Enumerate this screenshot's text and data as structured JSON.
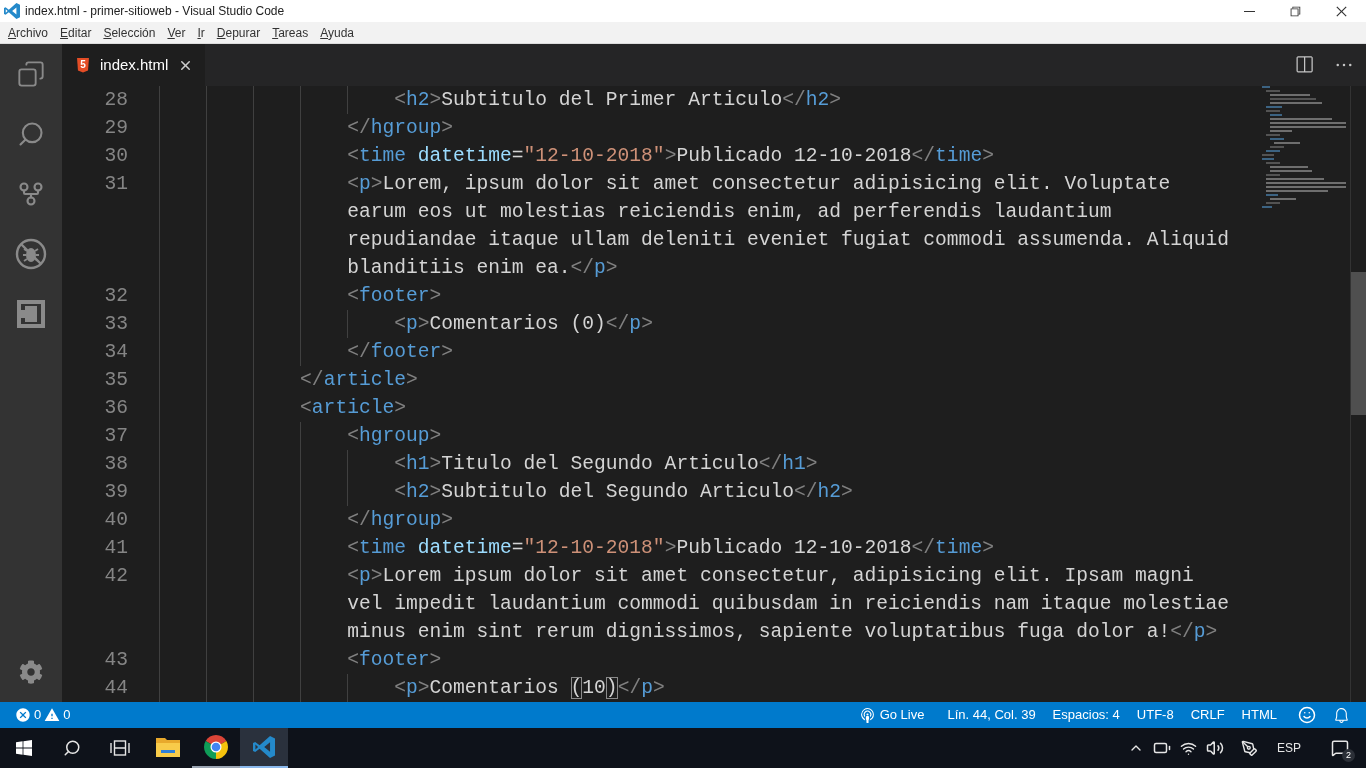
{
  "window": {
    "title": "index.html - primer-sitioweb - Visual Studio Code"
  },
  "menu": [
    "Archivo",
    "Editar",
    "Selección",
    "Ver",
    "Ir",
    "Depurar",
    "Tareas",
    "Ayuda"
  ],
  "tabs": [
    {
      "label": "index.html",
      "icon_text": "5",
      "selected": true
    }
  ],
  "editor": {
    "lines": [
      {
        "children": [
          {
            "children": [
              {
                "number": "28",
                "tokens": [
                  {
                    "kind": "punct",
                    "text": "<"
                  },
                  {
                    "kind": "tag",
                    "text": "h2"
                  },
                  {
                    "kind": "punct",
                    "text": ">"
                  },
                  {
                    "kind": "text",
                    "text": "Subtitulo del Primer Articulo"
                  },
                  {
                    "kind": "punct",
                    "text": "</"
                  },
                  {
                    "kind": "tag",
                    "text": "h2"
                  },
                  {
                    "kind": "punct",
                    "text": ">"
                  }
                ]
              }
            ]
          },
          {
            "number": "29",
            "tokens": [
              {
                "kind": "punct",
                "text": "</"
              },
              {
                "kind": "tag",
                "text": "hgroup"
              },
              {
                "kind": "punct",
                "text": ">"
              }
            ]
          },
          {
            "number": "30",
            "tokens": [
              {
                "kind": "punct",
                "text": "<"
              },
              {
                "kind": "tag",
                "text": "time"
              },
              {
                "kind": "attr",
                "text": " datetime"
              },
              {
                "kind": "text",
                "text": "="
              },
              {
                "kind": "string",
                "text": "\"12-10-2018\""
              },
              {
                "kind": "punct",
                "text": ">"
              },
              {
                "kind": "text",
                "text": "Publicado 12-10-2018"
              },
              {
                "kind": "punct",
                "text": "</"
              },
              {
                "kind": "tag",
                "text": "time"
              },
              {
                "kind": "punct",
                "text": ">"
              }
            ]
          },
          {
            "number": "31",
            "tokens": [
              {
                "kind": "punct",
                "text": "<"
              },
              {
                "kind": "tag",
                "text": "p"
              },
              {
                "kind": "punct",
                "text": ">"
              },
              {
                "kind": "text",
                "text": "Lorem, ipsum dolor sit amet consectetur adipisicing elit. Voluptate earum eos ut molestias reiciendis enim, ad perferendis laudantium repudiandae itaque ullam deleniti eveniet fugiat commodi assumenda. Aliquid blanditiis enim ea."
              },
              {
                "kind": "punct",
                "text": "</"
              },
              {
                "kind": "tag",
                "text": "p"
              },
              {
                "kind": "punct",
                "text": ">"
              }
            ]
          },
          {
            "number": "32",
            "tokens": [
              {
                "kind": "punct",
                "text": "<"
              },
              {
                "kind": "tag",
                "text": "footer"
              },
              {
                "kind": "punct",
                "text": ">"
              }
            ],
            "children": [
              {
                "number": "33",
                "tokens": [
                  {
                    "kind": "punct",
                    "text": "<"
                  },
                  {
                    "kind": "tag",
                    "text": "p"
                  },
                  {
                    "kind": "punct",
                    "text": ">"
                  },
                  {
                    "kind": "text",
                    "text": "Comentarios (0)"
                  },
                  {
                    "kind": "punct",
                    "text": "</"
                  },
                  {
                    "kind": "tag",
                    "text": "p"
                  },
                  {
                    "kind": "punct",
                    "text": ">"
                  }
                ]
              }
            ]
          },
          {
            "number": "34",
            "tokens": [
              {
                "kind": "punct",
                "text": "</"
              },
              {
                "kind": "tag",
                "text": "footer"
              },
              {
                "kind": "punct",
                "text": ">"
              }
            ]
          }
        ]
      },
      {
        "number": "35",
        "tokens": [
          {
            "kind": "punct",
            "text": "</"
          },
          {
            "kind": "tag",
            "text": "article"
          },
          {
            "kind": "punct",
            "text": ">"
          }
        ]
      },
      {
        "number": "36",
        "tokens": [
          {
            "kind": "punct",
            "text": "<"
          },
          {
            "kind": "tag",
            "text": "article"
          },
          {
            "kind": "punct",
            "text": ">"
          }
        ],
        "children": [
          {
            "number": "37",
            "tokens": [
              {
                "kind": "punct",
                "text": "<"
              },
              {
                "kind": "tag",
                "text": "hgroup"
              },
              {
                "kind": "punct",
                "text": ">"
              }
            ],
            "children": [
              {
                "number": "38",
                "tokens": [
                  {
                    "kind": "punct",
                    "text": "<"
                  },
                  {
                    "kind": "tag",
                    "text": "h1"
                  },
                  {
                    "kind": "punct",
                    "text": ">"
                  },
                  {
                    "kind": "text",
                    "text": "Titulo del Segundo Articulo"
                  },
                  {
                    "kind": "punct",
                    "text": "</"
                  },
                  {
                    "kind": "tag",
                    "text": "h1"
                  },
                  {
                    "kind": "punct",
                    "text": ">"
                  }
                ]
              },
              {
                "number": "39",
                "tokens": [
                  {
                    "kind": "punct",
                    "text": "<"
                  },
                  {
                    "kind": "tag",
                    "text": "h2"
                  },
                  {
                    "kind": "punct",
                    "text": ">"
                  },
                  {
                    "kind": "text",
                    "text": "Subtitulo del Segundo Articulo"
                  },
                  {
                    "kind": "punct",
                    "text": "</"
                  },
                  {
                    "kind": "tag",
                    "text": "h2"
                  },
                  {
                    "kind": "punct",
                    "text": ">"
                  }
                ]
              }
            ]
          },
          {
            "number": "40",
            "tokens": [
              {
                "kind": "punct",
                "text": "</"
              },
              {
                "kind": "tag",
                "text": "hgroup"
              },
              {
                "kind": "punct",
                "text": ">"
              }
            ]
          },
          {
            "number": "41",
            "tokens": [
              {
                "kind": "punct",
                "text": "<"
              },
              {
                "kind": "tag",
                "text": "time"
              },
              {
                "kind": "attr",
                "text": " datetime"
              },
              {
                "kind": "text",
                "text": "="
              },
              {
                "kind": "string",
                "text": "\"12-10-2018\""
              },
              {
                "kind": "punct",
                "text": ">"
              },
              {
                "kind": "text",
                "text": "Publicado 12-10-2018"
              },
              {
                "kind": "punct",
                "text": "</"
              },
              {
                "kind": "tag",
                "text": "time"
              },
              {
                "kind": "punct",
                "text": ">"
              }
            ]
          },
          {
            "number": "42",
            "tokens": [
              {
                "kind": "punct",
                "text": "<"
              },
              {
                "kind": "tag",
                "text": "p"
              },
              {
                "kind": "punct",
                "text": ">"
              },
              {
                "kind": "text",
                "text": "Lorem ipsum dolor sit amet consectetur, adipisicing elit. Ipsam magni vel impedit laudantium commodi quibusdam in reiciendis nam itaque molestiae minus enim sint rerum dignissimos, sapiente voluptatibus fuga dolor a!"
              },
              {
                "kind": "punct",
                "text": "</"
              },
              {
                "kind": "tag",
                "text": "p"
              },
              {
                "kind": "punct",
                "text": ">"
              }
            ]
          },
          {
            "number": "43",
            "tokens": [
              {
                "kind": "punct",
                "text": "<"
              },
              {
                "kind": "tag",
                "text": "footer"
              },
              {
                "kind": "punct",
                "text": ">"
              }
            ],
            "children": [
              {
                "number": "44",
                "tokens": [
                  {
                    "kind": "punct",
                    "text": "<"
                  },
                  {
                    "kind": "tag",
                    "text": "p"
                  },
                  {
                    "kind": "punct",
                    "text": ">"
                  },
                  {
                    "kind": "text",
                    "text": "Comentarios "
                  },
                  {
                    "kind": "bracket",
                    "text": "("
                  },
                  {
                    "kind": "text",
                    "text": "10"
                  },
                  {
                    "kind": "bracket",
                    "text": ")"
                  },
                  {
                    "kind": "punct",
                    "text": "</"
                  },
                  {
                    "kind": "tag",
                    "text": "p"
                  },
                  {
                    "kind": "punct",
                    "text": ">"
                  }
                ]
              }
            ]
          }
        ]
      }
    ]
  },
  "status_bar": {
    "problems": [
      {
        "kind": "error",
        "count": "0"
      },
      {
        "kind": "warning",
        "count": "0"
      }
    ],
    "items": [
      {
        "kind": "live",
        "label": "Go Live"
      },
      {
        "kind": "text",
        "label": "Lín. 44, Col. 39"
      },
      {
        "kind": "text",
        "label": "Espacios: 4"
      },
      {
        "kind": "text",
        "label": "UTF-8"
      },
      {
        "kind": "text",
        "label": "CRLF"
      },
      {
        "kind": "text",
        "label": "HTML"
      }
    ]
  },
  "taskbar": {
    "apps": [
      {
        "kind": "folder",
        "running": false,
        "selected": false
      },
      {
        "kind": "browser",
        "running": true,
        "selected": false
      },
      {
        "kind": "editor",
        "running": true,
        "selected": true
      }
    ],
    "language": "ESP",
    "notifications": "2"
  }
}
